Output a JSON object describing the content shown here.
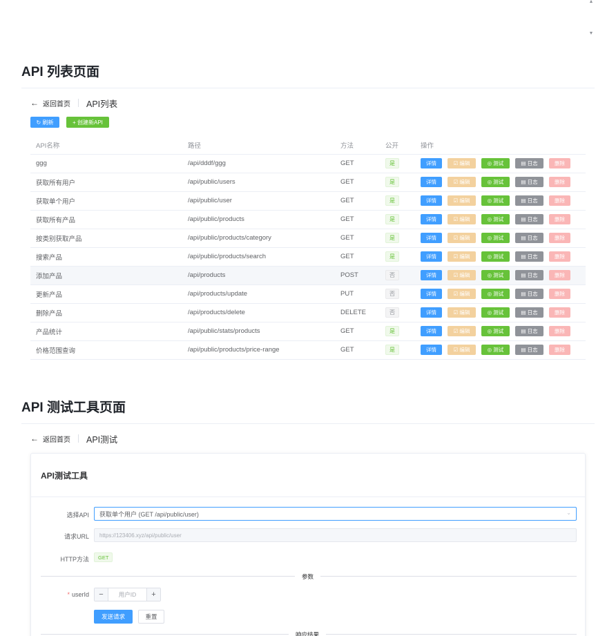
{
  "top": {
    "scroll_up": "▲",
    "scroll_down": "▼"
  },
  "list_section": {
    "title": "API 列表页面",
    "back_label": "返回首页",
    "back_icon": "←",
    "page_title": "API列表",
    "refresh_label": "↻ 刷新",
    "create_label": "+ 创建新API",
    "columns": [
      "API名称",
      "路径",
      "方法",
      "公开",
      "操作"
    ],
    "op_labels": {
      "detail": "详情",
      "edit": "☑ 编辑",
      "test": "◎ 测试",
      "log": "▤ 日志",
      "delete": "删除"
    },
    "rows": [
      {
        "name": "ggg",
        "path": "/api/dddf/ggg",
        "method": "GET",
        "public": "是",
        "is_public": true
      },
      {
        "name": "获取所有用户",
        "path": "/api/public/users",
        "method": "GET",
        "public": "是",
        "is_public": true
      },
      {
        "name": "获取单个用户",
        "path": "/api/public/user",
        "method": "GET",
        "public": "是",
        "is_public": true
      },
      {
        "name": "获取所有产品",
        "path": "/api/public/products",
        "method": "GET",
        "public": "是",
        "is_public": true
      },
      {
        "name": "按类别获取产品",
        "path": "/api/public/products/category",
        "method": "GET",
        "public": "是",
        "is_public": true
      },
      {
        "name": "搜索产品",
        "path": "/api/public/products/search",
        "method": "GET",
        "public": "是",
        "is_public": true
      },
      {
        "name": "添加产品",
        "path": "/api/products",
        "method": "POST",
        "public": "否",
        "is_public": false
      },
      {
        "name": "更新产品",
        "path": "/api/products/update",
        "method": "PUT",
        "public": "否",
        "is_public": false
      },
      {
        "name": "删除产品",
        "path": "/api/products/delete",
        "method": "DELETE",
        "public": "否",
        "is_public": false
      },
      {
        "name": "产品统计",
        "path": "/api/public/stats/products",
        "method": "GET",
        "public": "是",
        "is_public": true
      },
      {
        "name": "价格范围查询",
        "path": "/api/public/products/price-range",
        "method": "GET",
        "public": "是",
        "is_public": true
      }
    ]
  },
  "test_section": {
    "title": "API 测试工具页面",
    "back_label": "返回首页",
    "back_icon": "←",
    "page_title": "API测试",
    "card_title": "API测试工具",
    "select_label": "选择API",
    "select_value": "获取单个用户 (GET /api/public/user)",
    "url_label": "请求URL",
    "url_value": "https://123406.xyz/api/public/user",
    "method_label": "HTTP方法",
    "method_value": "GET",
    "params_divider": "参数",
    "param_label": "userId",
    "param_placeholder": "用户ID",
    "minus": "−",
    "plus": "+",
    "send_label": "发送请求",
    "reset_label": "重置",
    "response_divider": "响应结果"
  },
  "colors": {
    "primary": "#409eff",
    "success": "#67c23a",
    "warning_light": "#f3d19e",
    "info": "#909399",
    "danger_light": "#fab6b6"
  }
}
